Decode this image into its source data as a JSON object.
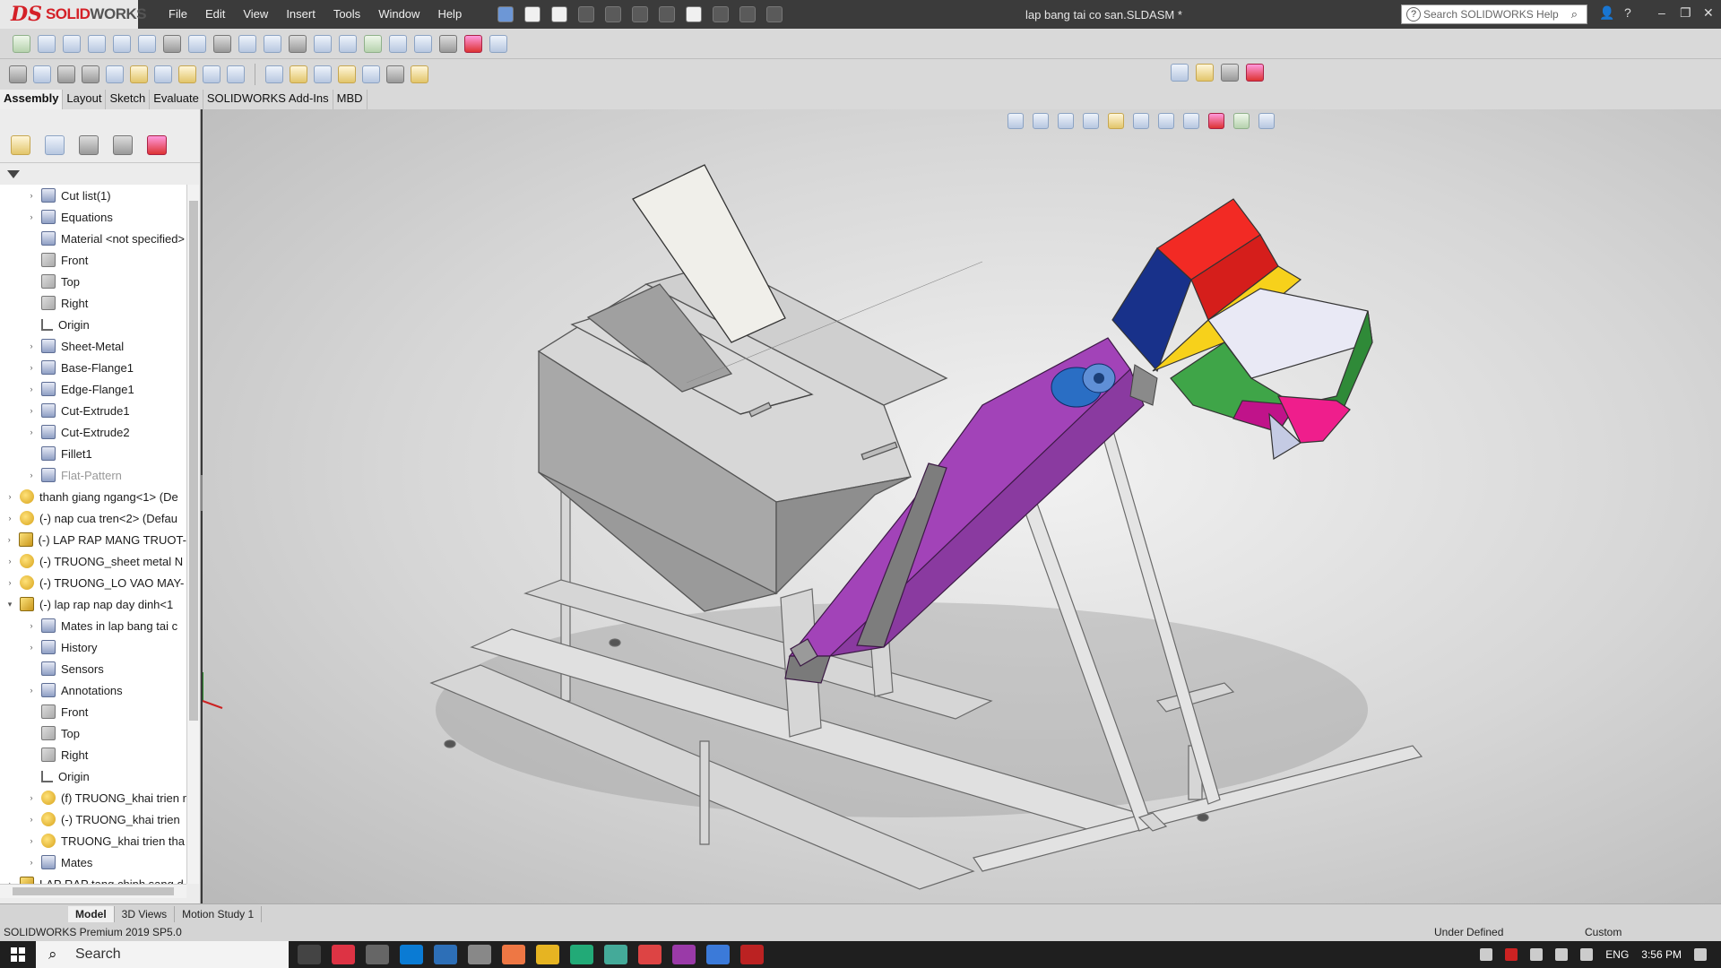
{
  "app": {
    "logo_ds": "DS",
    "logo_name_red": "SOLID",
    "logo_name_gray": "WORKS",
    "document_title": "lap bang tai co san.SLDASM *"
  },
  "menu": [
    "File",
    "Edit",
    "View",
    "Insert",
    "Tools",
    "Window",
    "Help"
  ],
  "help_search": {
    "placeholder": "Search SOLIDWORKS Help"
  },
  "command_tabs": [
    "Assembly",
    "Layout",
    "Sketch",
    "Evaluate",
    "SOLIDWORKS Add-Ins",
    "MBD"
  ],
  "feature_tree": [
    {
      "indent": 1,
      "arrow": true,
      "icon": "feat",
      "label": "Cut list(1)"
    },
    {
      "indent": 1,
      "arrow": true,
      "icon": "feat",
      "label": "Equations"
    },
    {
      "indent": 1,
      "arrow": false,
      "icon": "feat",
      "label": "Material <not specified>"
    },
    {
      "indent": 1,
      "arrow": false,
      "icon": "plane",
      "label": "Front"
    },
    {
      "indent": 1,
      "arrow": false,
      "icon": "plane",
      "label": "Top"
    },
    {
      "indent": 1,
      "arrow": false,
      "icon": "plane",
      "label": "Right"
    },
    {
      "indent": 1,
      "arrow": false,
      "icon": "origin",
      "label": "Origin"
    },
    {
      "indent": 1,
      "arrow": true,
      "icon": "feat",
      "label": "Sheet-Metal"
    },
    {
      "indent": 1,
      "arrow": true,
      "icon": "feat",
      "label": "Base-Flange1"
    },
    {
      "indent": 1,
      "arrow": true,
      "icon": "feat",
      "label": "Edge-Flange1"
    },
    {
      "indent": 1,
      "arrow": true,
      "icon": "feat",
      "label": "Cut-Extrude1"
    },
    {
      "indent": 1,
      "arrow": true,
      "icon": "feat",
      "label": "Cut-Extrude2"
    },
    {
      "indent": 1,
      "arrow": false,
      "icon": "feat",
      "label": "Fillet1"
    },
    {
      "indent": 1,
      "arrow": true,
      "icon": "feat",
      "label": "Flat-Pattern",
      "dim": true
    },
    {
      "indent": 0,
      "arrow": true,
      "icon": "part",
      "label": "thanh giang ngang<1> (De"
    },
    {
      "indent": 0,
      "arrow": true,
      "icon": "part",
      "label": "(-) nap cua tren<2> (Defau"
    },
    {
      "indent": 0,
      "arrow": true,
      "icon": "asm",
      "label": "(-) LAP RAP MANG TRUOT-"
    },
    {
      "indent": 0,
      "arrow": true,
      "icon": "part",
      "label": "(-) TRUONG_sheet metal N"
    },
    {
      "indent": 0,
      "arrow": true,
      "icon": "part",
      "label": "(-) TRUONG_LO VAO MAY-"
    },
    {
      "indent": 0,
      "arrow": "down",
      "icon": "asm",
      "label": "(-) lap rap nap day dinh<1"
    },
    {
      "indent": 1,
      "arrow": true,
      "icon": "feat",
      "label": "Mates in lap bang tai c"
    },
    {
      "indent": 1,
      "arrow": true,
      "icon": "feat",
      "label": "History"
    },
    {
      "indent": 1,
      "arrow": false,
      "icon": "feat",
      "label": "Sensors"
    },
    {
      "indent": 1,
      "arrow": true,
      "icon": "feat",
      "label": "Annotations"
    },
    {
      "indent": 1,
      "arrow": false,
      "icon": "plane",
      "label": "Front"
    },
    {
      "indent": 1,
      "arrow": false,
      "icon": "plane",
      "label": "Top"
    },
    {
      "indent": 1,
      "arrow": false,
      "icon": "plane",
      "label": "Right"
    },
    {
      "indent": 1,
      "arrow": false,
      "icon": "origin",
      "label": "Origin"
    },
    {
      "indent": 1,
      "arrow": true,
      "icon": "part",
      "label": "(f) TRUONG_khai trien r"
    },
    {
      "indent": 1,
      "arrow": true,
      "icon": "part",
      "label": "(-) TRUONG_khai trien"
    },
    {
      "indent": 1,
      "arrow": true,
      "icon": "part",
      "label": "TRUONG_khai trien tha"
    },
    {
      "indent": 1,
      "arrow": true,
      "icon": "feat",
      "label": "Mates"
    },
    {
      "indent": 0,
      "arrow": true,
      "icon": "asm",
      "label": "LAP RAP tang chinh sang d"
    }
  ],
  "model_tabs": [
    "Model",
    "3D Views",
    "Motion Study 1"
  ],
  "status": {
    "product": "SOLIDWORKS Premium 2019 SP5.0",
    "state": "Under Defined",
    "units": "Custom"
  },
  "taskbar": {
    "search_label": "Search",
    "language": "ENG",
    "time": "3:56 PM"
  },
  "colors": {
    "hopper_gray": "#9a9a9a",
    "conveyor_purple": "#a243b8",
    "chute_red": "#f22a24",
    "chute_navy": "#18318a",
    "chute_green": "#3fa548",
    "chute_pink": "#ef1e8c",
    "motor_blue": "#2a6ec4"
  }
}
